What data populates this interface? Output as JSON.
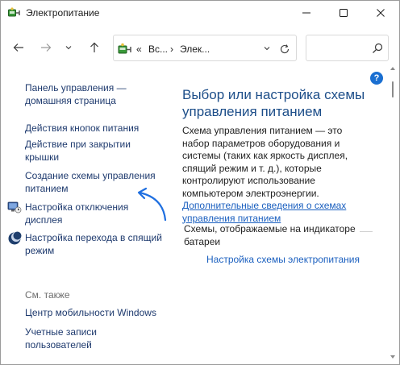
{
  "window": {
    "title": "Электропитание",
    "icon": "power-options-icon"
  },
  "titlebar_buttons": {
    "minimize": "minimize-icon",
    "maximize": "maximize-icon",
    "close": "close-icon"
  },
  "navigation": {
    "back": "back-arrow-icon",
    "forward": "forward-arrow-icon",
    "recent": "chevron-down-icon",
    "up": "up-arrow-icon",
    "address": {
      "overflow": "«",
      "segment1": "Вс...",
      "separator": "›",
      "segment2": "Элек...",
      "dropdown": "chevron-down-icon",
      "refresh": "refresh-icon"
    },
    "search": {
      "placeholder": "",
      "icon": "search-icon"
    }
  },
  "sidebar": {
    "items": [
      {
        "label": "Панель управления — домашняя страница"
      },
      {
        "label": "Действия кнопок питания"
      },
      {
        "label": "Действие при закрытии крышки"
      },
      {
        "label": "Создание схемы управления питанием"
      },
      {
        "label": "Настройка отключения дисплея",
        "icon": "display-icon"
      },
      {
        "label": "Настройка перехода в спящий режим",
        "icon": "moon-icon"
      }
    ],
    "see_also": {
      "heading": "См. также",
      "items": [
        {
          "label": "Центр мобильности Windows"
        },
        {
          "label": "Учетные записи пользователей"
        }
      ]
    }
  },
  "main": {
    "help": "?",
    "title": "Выбор или настройка схемы управления питанием",
    "description": "Схема управления питанием — это набор параметров оборудования и системы (таких как яркость дисплея, спящий режим и т. д.), которые контролируют использование компьютером электроэнергии.",
    "more_link": "Дополнительные сведения о схемах управления питанием",
    "schemes_label": "Схемы, отображаемые на индикаторе батареи",
    "configure_link": "Настройка схемы электропитания"
  },
  "colors": {
    "link": "#1e3a6e",
    "title": "#1d4e89",
    "accent_link": "#1a5fbf",
    "annotation_arrow": "#1f6fe0"
  }
}
